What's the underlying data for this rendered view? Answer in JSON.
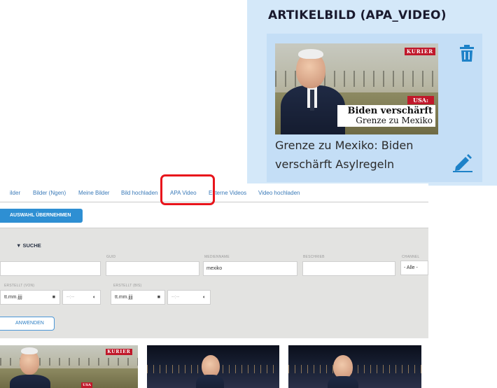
{
  "artikel": {
    "title": "ARTIKELBILD (APA_VIDEO)",
    "thumbnail": {
      "brand": "KURIER",
      "label": "USA:",
      "headline_line1": "Biden verschärft",
      "headline_line2": "Grenze zu Mexiko"
    },
    "caption": "Grenze zu Mexiko: Biden verschärft Asylregeln",
    "trash_icon": "trash-icon",
    "edit_icon": "pencil-icon",
    "accent_color": "#1e82c8"
  },
  "tabs": [
    "ilder",
    "Bilder (Ngen)",
    "Meine Bilder",
    "Bild hochladen",
    "APA Video",
    "Externe Videos",
    "Video hochladen"
  ],
  "active_tab": "APA Video",
  "highlight_color": "#e8141b",
  "toolbar": {
    "uebernehmen_label": "AUSWAHL ÜBERNEHMEN"
  },
  "search": {
    "heading": "▼ SUCHE",
    "label_id": "GUID",
    "label_medienname": "MEDIENNAME",
    "label_beschrieb": "BESCHRIEB",
    "label_channel": "CHANNEL",
    "medienname_value": "mexiko",
    "channel_value": "- Alle -",
    "label_erstellt_von": "ERSTELLT (VON)",
    "label_erstellt_bis": "ERSTELLT (BIS)",
    "date_placeholder": "tt.mm.jjjj",
    "time_placeholder": "--:--",
    "apply_label": "ANWENDEN"
  },
  "results": {
    "first_brand": "KURIER",
    "first_label": "USA"
  }
}
